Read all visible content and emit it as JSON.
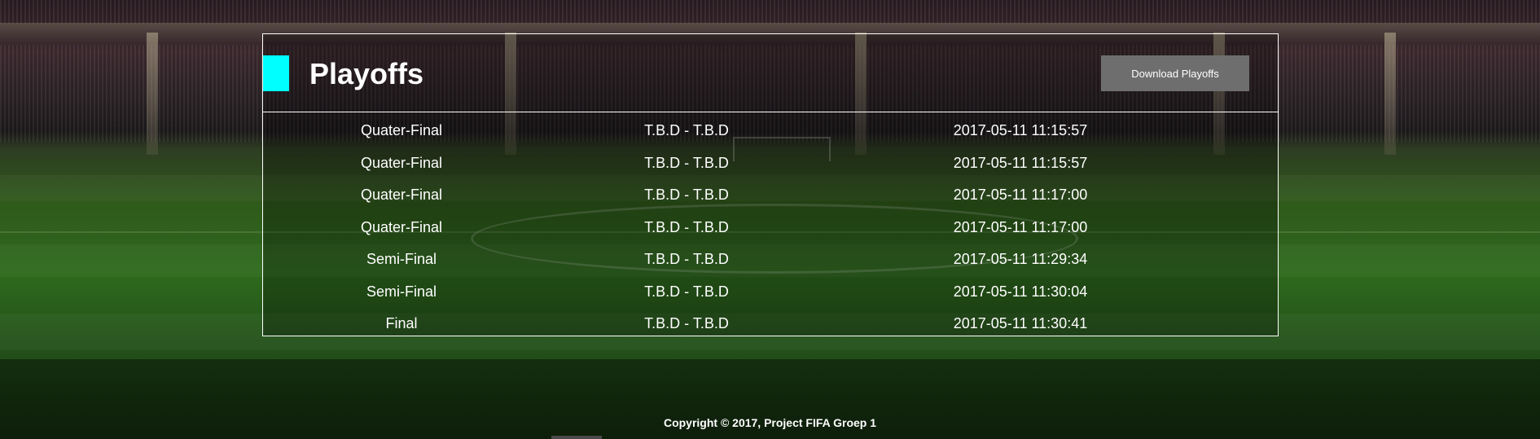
{
  "header": {
    "title": "Playoffs",
    "download_label": "Download Playoffs"
  },
  "table": {
    "rows": [
      {
        "round": "Quater-Final",
        "match": "T.B.D - T.B.D",
        "datetime": "2017-05-11 11:15:57"
      },
      {
        "round": "Quater-Final",
        "match": "T.B.D - T.B.D",
        "datetime": "2017-05-11 11:15:57"
      },
      {
        "round": "Quater-Final",
        "match": "T.B.D - T.B.D",
        "datetime": "2017-05-11 11:17:00"
      },
      {
        "round": "Quater-Final",
        "match": "T.B.D - T.B.D",
        "datetime": "2017-05-11 11:17:00"
      },
      {
        "round": "Semi-Final",
        "match": "T.B.D - T.B.D",
        "datetime": "2017-05-11 11:29:34"
      },
      {
        "round": "Semi-Final",
        "match": "T.B.D - T.B.D",
        "datetime": "2017-05-11 11:30:04"
      },
      {
        "round": "Final",
        "match": "T.B.D - T.B.D",
        "datetime": "2017-05-11 11:30:41"
      }
    ]
  },
  "footer": {
    "copyright": "Copyright © 2017, Project FIFA Groep 1"
  },
  "colors": {
    "accent": "#00ffff",
    "button_bg": "#6e6e6e"
  }
}
